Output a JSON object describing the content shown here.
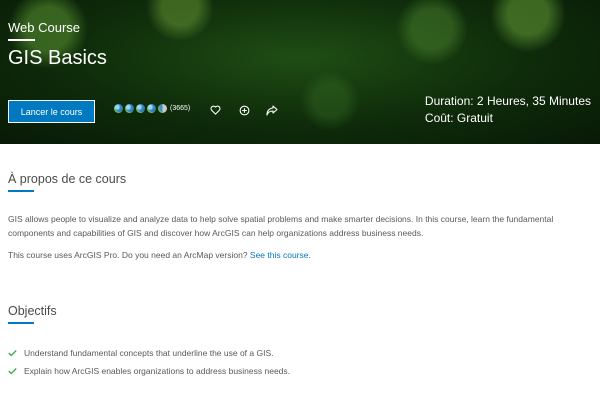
{
  "hero": {
    "eyebrow": "Web Course",
    "title": "GIS Basics",
    "launch_label": "Lancer le cours",
    "rating": {
      "value": 4.5,
      "max": 5,
      "count_text": "(3665)"
    },
    "duration": "Duration: 2 Heures, 35 Minutes",
    "cost": "Coût: Gratuit",
    "icons": [
      "heart-icon",
      "add-circle-icon",
      "share-icon"
    ]
  },
  "about": {
    "heading": "À propos de ce cours",
    "paragraph1": "GIS allows people to visualize and analyze data to help solve spatial problems and make smarter decisions. In this course, learn the fundamental components and capabilities of GIS and discover how ArcGIS can help organizations address business needs.",
    "paragraph2_prefix": "This course uses ArcGIS Pro. Do you need an ArcMap version? ",
    "paragraph2_link": "See this course",
    "paragraph2_suffix": "."
  },
  "objectives": {
    "heading": "Objectifs",
    "items": [
      "Understand fundamental concepts that underline the use of a GIS.",
      "Explain how ArcGIS enables organizations to address business needs."
    ]
  },
  "colors": {
    "accent": "#0079c1",
    "check": "#35ac46",
    "hero_bg": "#0e2b0a"
  }
}
